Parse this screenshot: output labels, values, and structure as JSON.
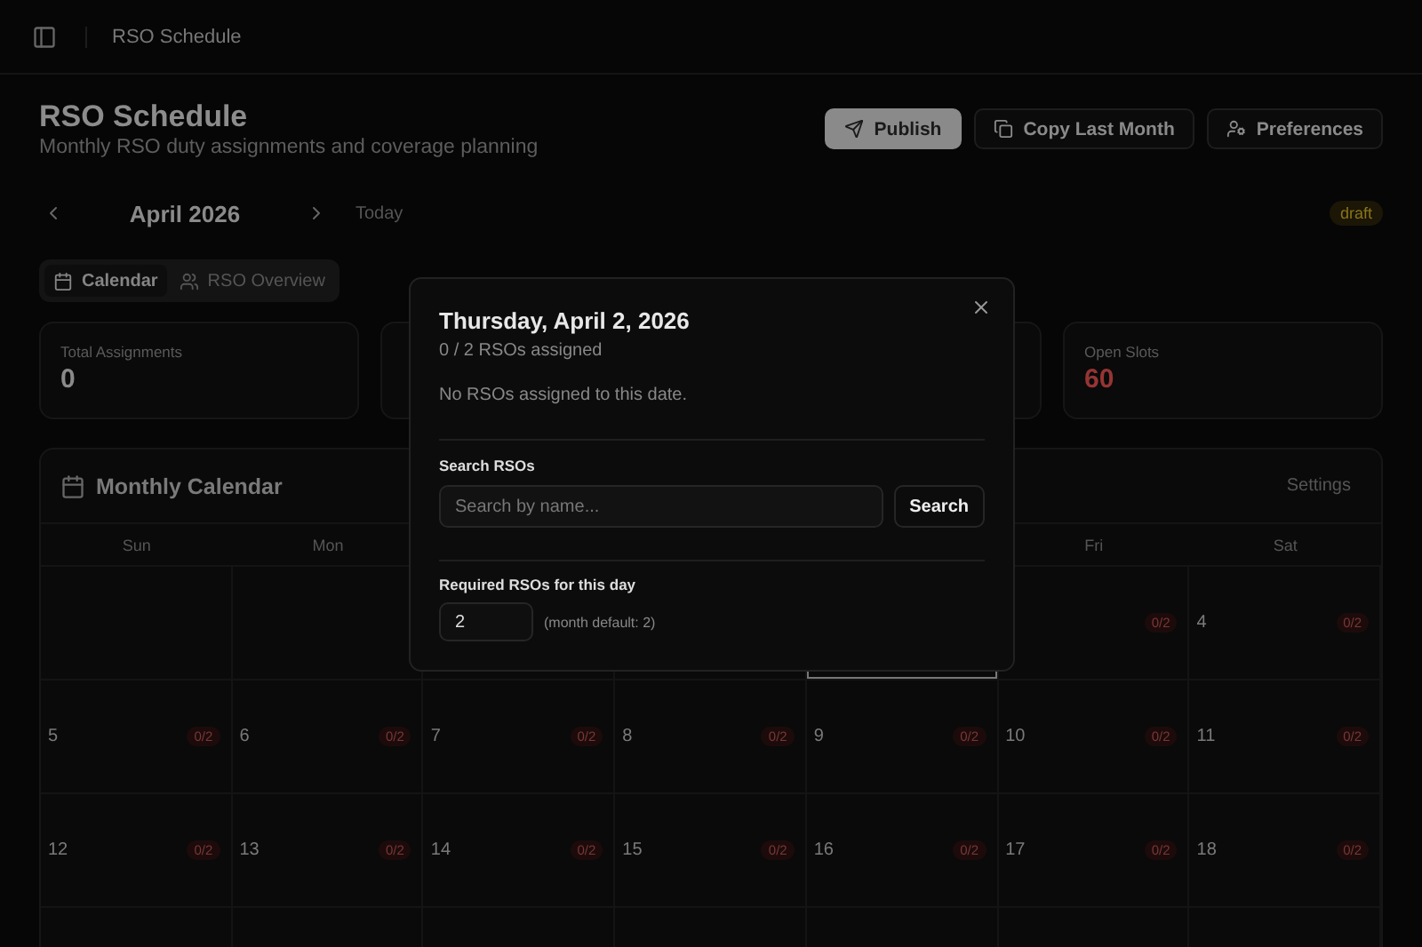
{
  "topbar": {
    "title": "RSO Schedule"
  },
  "header": {
    "title": "RSO Schedule",
    "subtitle": "Monthly RSO duty assignments and coverage planning"
  },
  "actions": [
    {
      "label": "Publish",
      "kind": "primary"
    },
    {
      "label": "Copy Last Month",
      "kind": "copy"
    },
    {
      "label": "Preferences",
      "kind": "preferences"
    }
  ],
  "month_nav": {
    "month": "April 2026",
    "today": "Today",
    "status": "draft"
  },
  "tabs": [
    {
      "label": "Calendar",
      "selected": true
    },
    {
      "label": "RSO Overview",
      "selected": false
    }
  ],
  "stats": [
    {
      "label": "Total Assignments",
      "value": "0",
      "alert": false
    },
    {
      "label": "Open Slots",
      "value": "60",
      "alert": true
    }
  ],
  "calendar": {
    "title": "Monthly Calendar",
    "settings": "Settings",
    "weekdays": {
      "start": [
        "Sun",
        "Mon"
      ],
      "end": [
        "Fri",
        "Sat"
      ]
    },
    "weeks": [
      [
        {
          "selected": false
        },
        {
          "selected": false
        },
        {
          "selected": false
        },
        {
          "selected": false
        },
        {
          "selected": true
        },
        {
          "badge": "0/2",
          "selected": false
        },
        {
          "day": "4",
          "badge": "0/2",
          "selected": false
        }
      ],
      [
        {
          "day": "5",
          "badge": "0/2",
          "selected": false
        },
        {
          "day": "6",
          "badge": "0/2",
          "selected": false
        },
        {
          "day": "7",
          "badge": "0/2",
          "selected": false
        },
        {
          "day": "8",
          "badge": "0/2",
          "selected": false
        },
        {
          "day": "9",
          "badge": "0/2",
          "selected": false
        },
        {
          "day": "10",
          "badge": "0/2",
          "selected": false
        },
        {
          "day": "11",
          "badge": "0/2",
          "selected": false
        }
      ],
      [
        {
          "day": "12",
          "badge": "0/2",
          "selected": false
        },
        {
          "day": "13",
          "badge": "0/2",
          "selected": false
        },
        {
          "day": "14",
          "badge": "0/2",
          "selected": false
        },
        {
          "day": "15",
          "badge": "0/2",
          "selected": false
        },
        {
          "day": "16",
          "badge": "0/2",
          "selected": false
        },
        {
          "day": "17",
          "badge": "0/2",
          "selected": false
        },
        {
          "day": "18",
          "badge": "0/2",
          "selected": false
        }
      ],
      [
        {
          "selected": false
        },
        {
          "selected": false
        },
        {
          "selected": false
        },
        {
          "selected": false
        },
        {
          "selected": false
        },
        {
          "selected": false
        },
        {
          "selected": false
        }
      ]
    ]
  },
  "dialog": {
    "title": "Thursday, April 2, 2026",
    "assigned": "0 / 2 RSOs assigned",
    "note": "No RSOs assigned to this date.",
    "search_label": "Search RSOs",
    "search_placeholder": "Search by name...",
    "search_button": "Search",
    "required_label": "Required RSOs for this day",
    "required_value": "2",
    "required_hint": "(month default: 2)"
  }
}
